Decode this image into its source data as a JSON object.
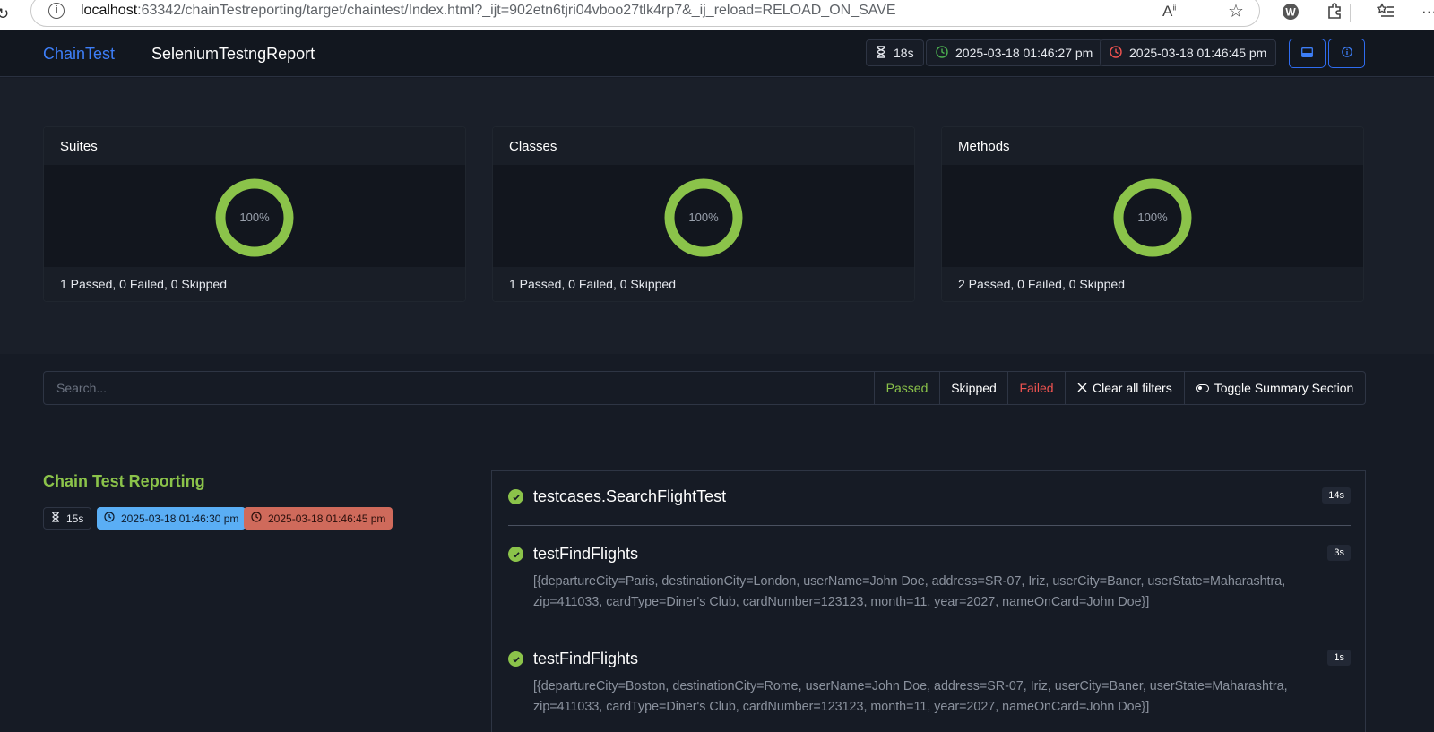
{
  "browser": {
    "url_host": "localhost",
    "url_rest": ":63342/chainTestreporting/target/chaintest/Index.html?_ijt=902etn6tjri04vboo27tlk4rp7&_ij_reload=RELOAD_ON_SAVE"
  },
  "header": {
    "brand": "ChainTest",
    "title": "SeleniumTestngReport",
    "duration": "18s",
    "start_time": "2025-03-18 01:46:27 pm",
    "end_time": "2025-03-18 01:46:45 pm"
  },
  "summary": {
    "cards": [
      {
        "title": "Suites",
        "percent": "100%",
        "footer": "1 Passed, 0 Failed, 0 Skipped",
        "pass_fraction": 1.0
      },
      {
        "title": "Classes",
        "percent": "100%",
        "footer": "1 Passed, 0 Failed, 0 Skipped",
        "pass_fraction": 1.0
      },
      {
        "title": "Methods",
        "percent": "100%",
        "footer": "2 Passed, 0 Failed, 0 Skipped",
        "pass_fraction": 1.0
      }
    ]
  },
  "filters": {
    "search_placeholder": "Search...",
    "passed": "Passed",
    "skipped": "Skipped",
    "failed": "Failed",
    "clear": "Clear all filters",
    "toggle": "Toggle Summary Section"
  },
  "suite": {
    "name": "Chain Test Reporting",
    "duration": "15s",
    "start": "2025-03-18 01:46:30 pm",
    "end": "2025-03-18 01:46:45 pm"
  },
  "tests": {
    "class_name": "testcases.SearchFlightTest",
    "class_duration": "14s",
    "methods": [
      {
        "name": "testFindFlights",
        "duration": "3s",
        "params": "[{departureCity=Paris, destinationCity=London, userName=John Doe, address=SR-07, Iriz, userCity=Baner, userState=Maharashtra, zip=411033, cardType=Diner's Club, cardNumber=123123, month=11, year=2027, nameOnCard=John Doe}]"
      },
      {
        "name": "testFindFlights",
        "duration": "1s",
        "params": "[{departureCity=Boston, destinationCity=Rome, userName=John Doe, address=SR-07, Iriz, userCity=Baner, userState=Maharashtra, zip=411033, cardType=Diner's Club, cardNumber=123123, month=11, year=2027, nameOnCard=John Doe}]"
      }
    ]
  },
  "colors": {
    "brand": "#3d7ef7",
    "pass": "#8bc34a",
    "fail": "#ef5350",
    "start_badge": "#5aaef5",
    "end_badge": "#cf6a5b"
  }
}
